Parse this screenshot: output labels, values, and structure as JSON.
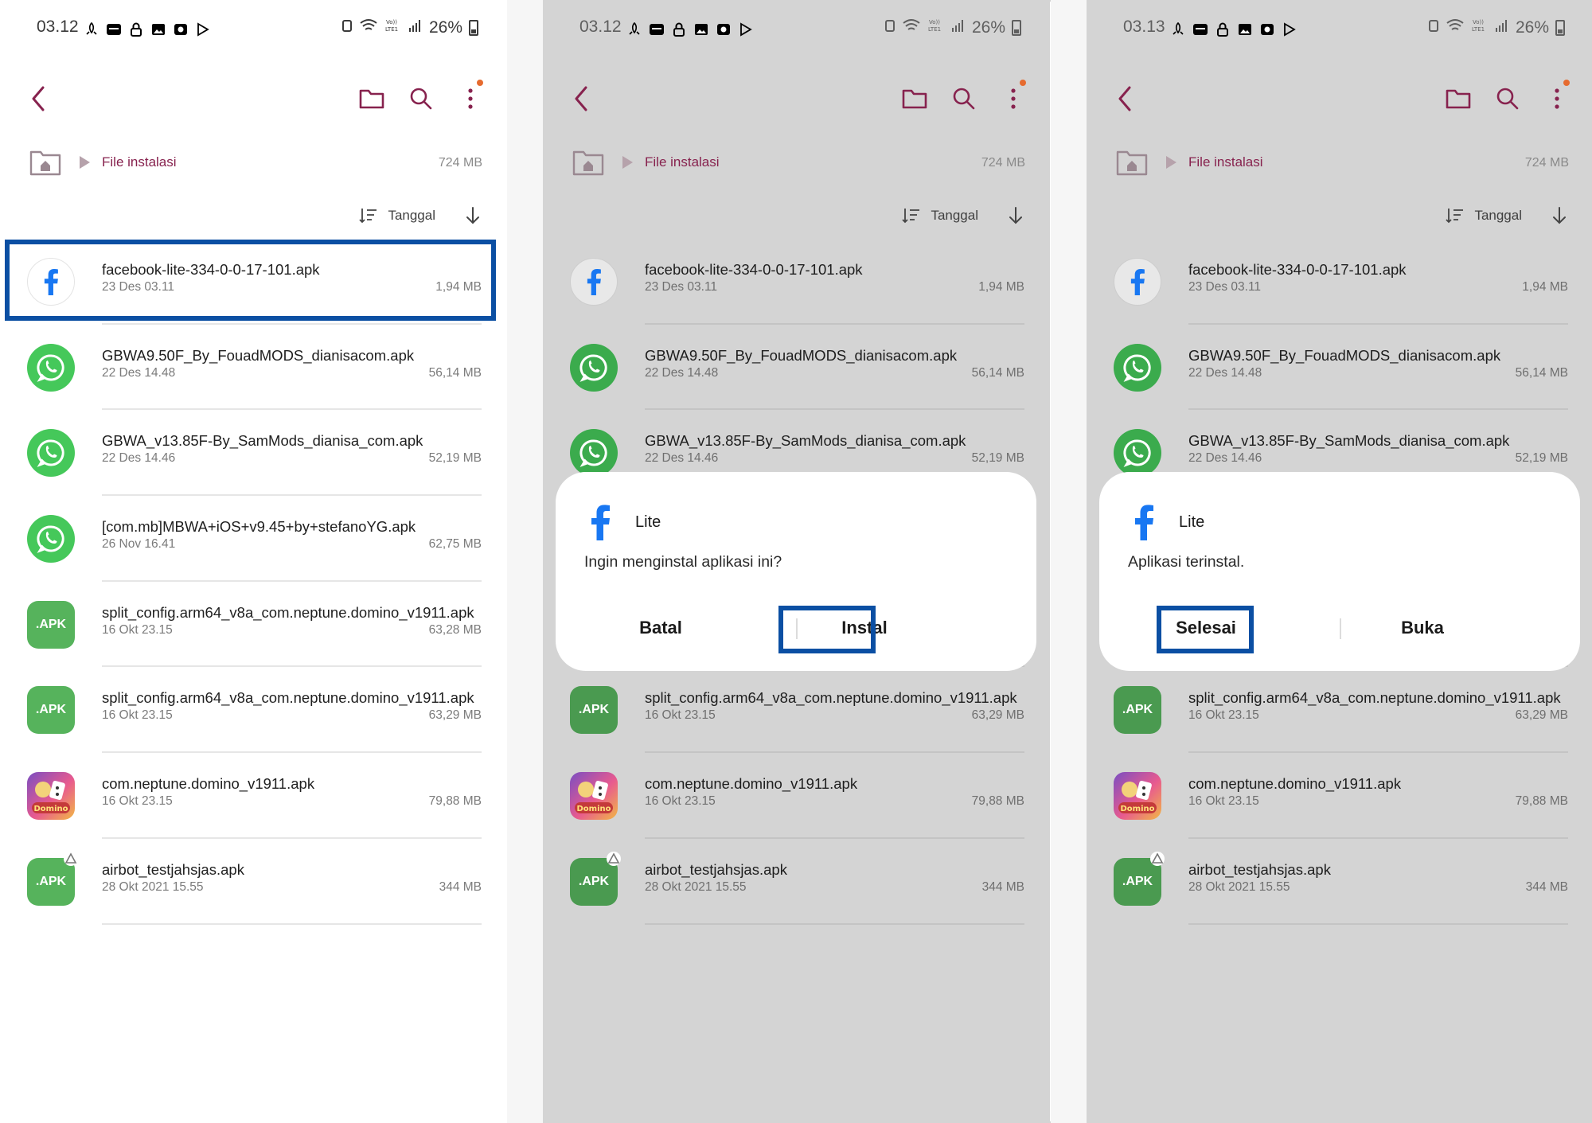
{
  "panels": [
    {
      "status": {
        "time": "03.12",
        "battery": "26%"
      },
      "breadcrumb": {
        "label": "File instalasi",
        "size": "724 MB"
      },
      "sort": {
        "label": "Tanggal"
      }
    },
    {
      "status": {
        "time": "03.12",
        "battery": "26%"
      },
      "breadcrumb": {
        "label": "File instalasi",
        "size": "724 MB"
      },
      "sort": {
        "label": "Tanggal"
      },
      "dialog": {
        "app_name": "Lite",
        "message": "Ingin menginstal aplikasi ini?",
        "left_button": "Batal",
        "right_button": "Instal",
        "highlighted": "right"
      }
    },
    {
      "status": {
        "time": "03.13",
        "battery": "26%"
      },
      "breadcrumb": {
        "label": "File instalasi",
        "size": "724 MB"
      },
      "sort": {
        "label": "Tanggal"
      },
      "dialog": {
        "app_name": "Lite",
        "message": "Aplikasi terinstal.",
        "left_button": "Selesai",
        "right_button": "Buka",
        "highlighted": "left"
      }
    }
  ],
  "files": [
    {
      "name": "facebook-lite-334-0-0-17-101.apk",
      "date": "23 Des 03.11",
      "size": "1,94 MB",
      "icon": "facebook-icon"
    },
    {
      "name": "GBWA9.50F_By_FouadMODS_dianisacom.apk",
      "date": "22 Des 14.48",
      "size": "56,14 MB",
      "icon": "whatsapp-icon"
    },
    {
      "name": "GBWA_v13.85F-By_SamMods_dianisa_com.apk",
      "date": "22 Des 14.46",
      "size": "52,19 MB",
      "icon": "whatsapp-icon"
    },
    {
      "name": "[com.mb]MBWA+iOS+v9.45+by+stefanoYG.apk",
      "date": "26 Nov 16.41",
      "size": "62,75 MB",
      "icon": "whatsapp-icon"
    },
    {
      "name": "split_config.arm64_v8a_com.neptune.domino_v1911.apk",
      "date": "16 Okt 23.15",
      "size": "63,28 MB",
      "icon": "apk-icon"
    },
    {
      "name": "split_config.arm64_v8a_com.neptune.domino_v1911.apk",
      "date": "16 Okt 23.15",
      "size": "63,29 MB",
      "icon": "apk-icon"
    },
    {
      "name": "com.neptune.domino_v1911.apk",
      "date": "16 Okt 23.15",
      "size": "79,88 MB",
      "icon": "domino-game-icon"
    },
    {
      "name": "airbot_testjahsjas.apk",
      "date": "28 Okt 2021 15.55",
      "size": "344 MB",
      "icon": "apk-icon"
    }
  ],
  "apk_badge_text": ".APK",
  "colors": {
    "accent": "#87224e",
    "highlight": "#0b4fa3",
    "whatsapp": "#45c85a",
    "apk": "#56b35c",
    "facebook": "#1877f2",
    "dim": "#d4d4d4"
  }
}
